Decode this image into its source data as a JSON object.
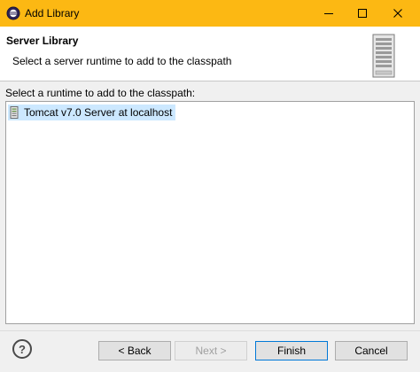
{
  "window": {
    "title": "Add Library",
    "controls": {
      "minimize": "minimize-icon",
      "maximize": "maximize-icon",
      "close": "close-icon"
    }
  },
  "header": {
    "title": "Server Library",
    "description": "Select a server runtime to add to the classpath",
    "image": "server-tower-icon"
  },
  "runtime_list": {
    "label": "Select a runtime to add to the classpath:",
    "items": [
      {
        "label": "Tomcat v7.0 Server at localhost",
        "icon": "server-runtime-icon",
        "selected": true
      }
    ]
  },
  "footer": {
    "help": "?",
    "back": "< Back",
    "next": "Next >",
    "finish": "Finish",
    "cancel": "Cancel"
  },
  "colors": {
    "titlebar": "#fcb813",
    "selection": "#cce8ff",
    "default_button_border": "#0078d7"
  }
}
